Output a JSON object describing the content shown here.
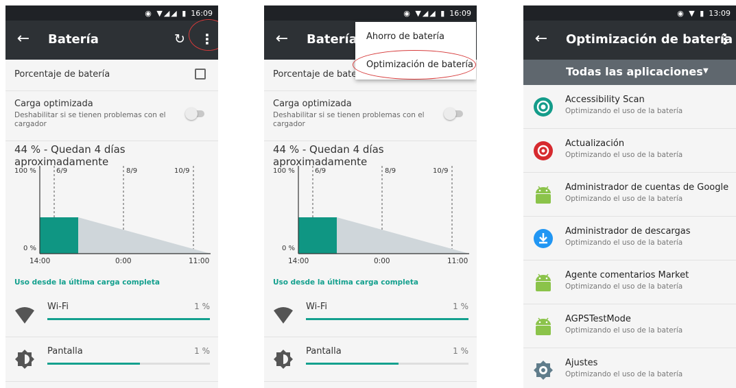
{
  "colors": {
    "accent": "#14a08e",
    "toolbar": "#2d3135",
    "statusbar": "#1f2226",
    "annotation_ring": "#d63a3a",
    "filter_bar": "#5f676e"
  },
  "screen1": {
    "status_time": "16:09",
    "title": "Batería",
    "battery_percentage_label": "Porcentaje de batería",
    "optimized_charge_title": "Carga optimizada",
    "optimized_charge_desc": "Deshabilitar si se tienen problemas con el cargador",
    "estimate": "44 % - Quedan 4 días aproximadamente",
    "usage_header": "Uso desde la última carga completa",
    "usage": [
      {
        "name": "Wi-Fi",
        "percent": "1 %",
        "fill_fraction": 1.0,
        "icon": "wifi-icon"
      },
      {
        "name": "Pantalla",
        "percent": "1 %",
        "fill_fraction": 0.57,
        "icon": "brightness-icon"
      }
    ]
  },
  "screen2": {
    "status_time": "16:09",
    "title": "Batería",
    "battery_percentage_label": "Porcentaje de bater",
    "optimized_charge_title": "Carga optimizada",
    "optimized_charge_desc": "Deshabilitar si se tienen problemas con el cargador",
    "estimate": "44 % - Quedan 4 días aproximadamente",
    "usage_header": "Uso desde la última carga completa",
    "menu": [
      "Ahorro de batería",
      "Optimización de batería"
    ],
    "usage": [
      {
        "name": "Wi-Fi",
        "percent": "1 %",
        "fill_fraction": 1.0,
        "icon": "wifi-icon"
      },
      {
        "name": "Pantalla",
        "percent": "1 %",
        "fill_fraction": 0.57,
        "icon": "brightness-icon"
      }
    ]
  },
  "screen3": {
    "status_time": "13:09",
    "title": "Optimización de batería",
    "filter": "Todas las aplicaciones",
    "apps": [
      {
        "name": "Accessibility Scan",
        "status": "Optimizando el uso de la batería",
        "icon": "accessibility-scan-icon"
      },
      {
        "name": "Actualización",
        "status": "Optimizando el uso de la batería",
        "icon": "update-icon"
      },
      {
        "name": "Administrador de cuentas de Google",
        "status": "Optimizando el uso de la batería",
        "icon": "android-icon"
      },
      {
        "name": "Administrador de descargas",
        "status": "Optimizando el uso de la batería",
        "icon": "download-icon"
      },
      {
        "name": "Agente comentarios Market",
        "status": "Optimizando el uso de la batería",
        "icon": "android-icon"
      },
      {
        "name": "AGPSTestMode",
        "status": "Optimizando el uso de la batería",
        "icon": "android-icon"
      },
      {
        "name": "Ajustes",
        "status": "Optimizando el uso de la batería",
        "icon": "settings-gear-icon"
      }
    ]
  },
  "battery_chart": {
    "y_labels": [
      "100 %",
      "0 %"
    ],
    "top_date_labels": [
      "6/9",
      "8/9",
      "10/9"
    ],
    "x_labels": [
      "14:00",
      "0:00",
      "11:00"
    ],
    "level_percent": 44
  }
}
